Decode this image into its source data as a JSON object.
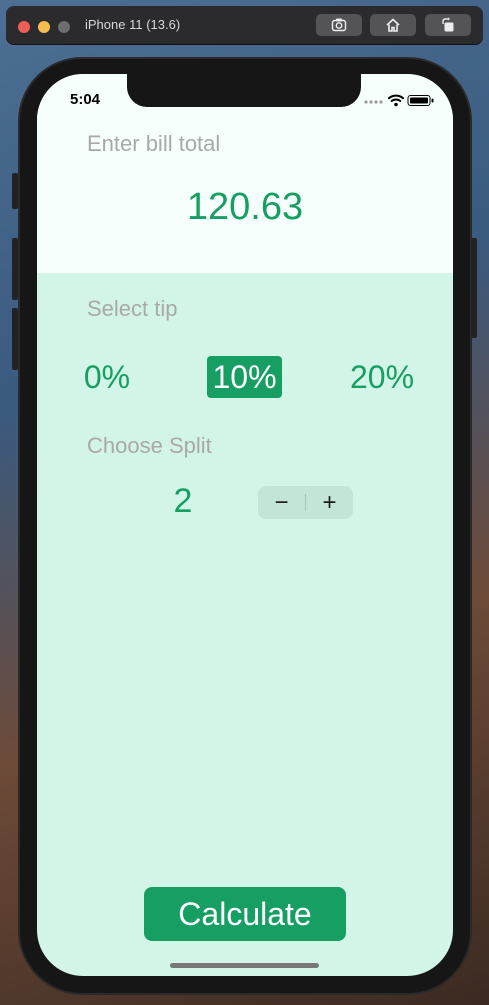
{
  "simulator": {
    "title": "iPhone 11 (13.6)",
    "buttons": [
      "screenshot-icon",
      "home-icon",
      "rotate-icon"
    ]
  },
  "status_bar": {
    "time": "5:04",
    "icons": [
      "cellular-signal-icon",
      "wifi-icon",
      "battery-icon"
    ]
  },
  "bill": {
    "label": "Enter bill total",
    "value": "120.63"
  },
  "tip": {
    "label": "Select tip",
    "options": [
      "0%",
      "10%",
      "20%"
    ],
    "selected": "10%"
  },
  "split": {
    "label": "Choose Split",
    "value": "2",
    "decrement": "−",
    "increment": "+"
  },
  "actions": {
    "calculate": "Calculate"
  },
  "colors": {
    "accent": "#179f63",
    "background": "#d3f5e8",
    "top_background": "#f6fffc",
    "label_gray": "#a9a9a9"
  }
}
